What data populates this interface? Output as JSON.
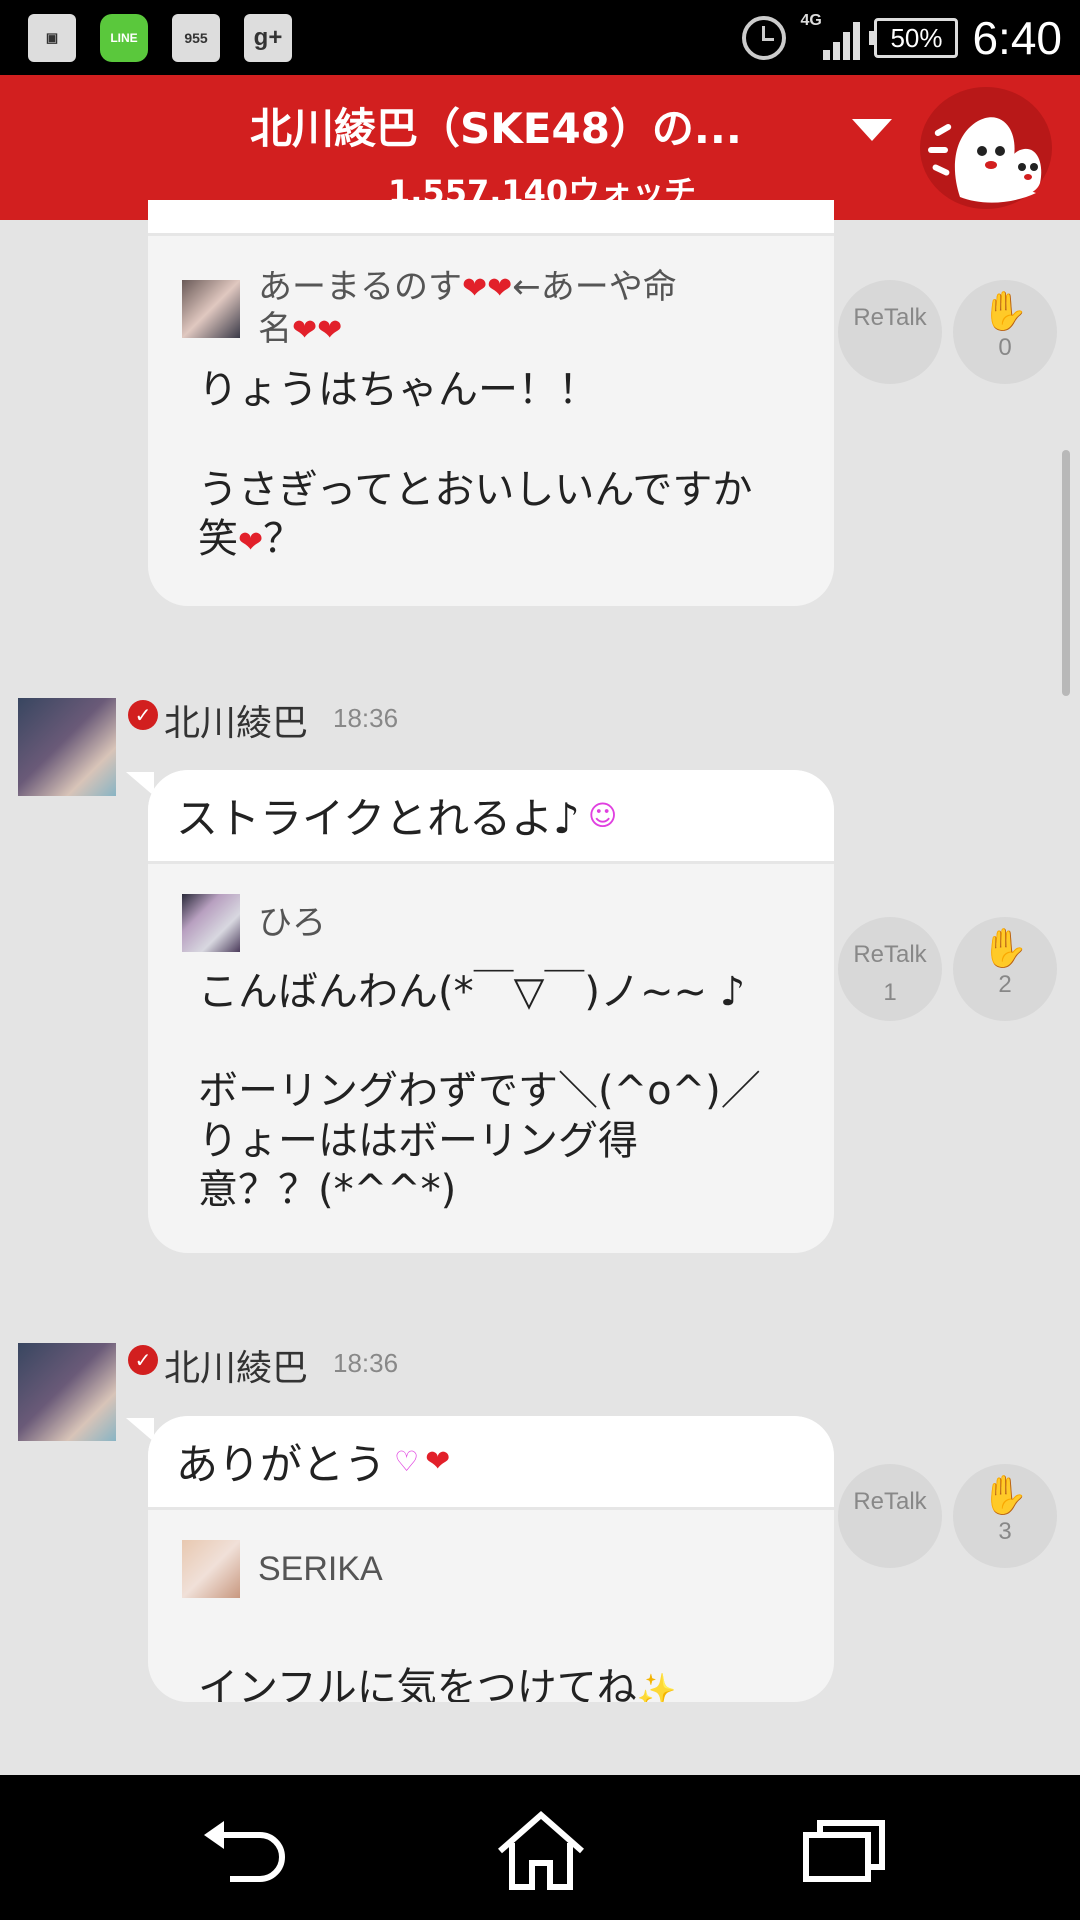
{
  "status_bar": {
    "icons": [
      "gallery-icon",
      "line-icon",
      "955-icon",
      "google-plus-icon"
    ],
    "line_label": "LINE",
    "app3_label": "955",
    "gplus_label": "g+",
    "network": "4G",
    "battery": "50%",
    "time": "6:40"
  },
  "header": {
    "title": "北川綾巴（SKE48）の...",
    "watch_count": "1,557,140ウォッチ"
  },
  "actions": {
    "retalk": "ReTalk"
  },
  "messages": [
    {
      "reply_name_a": "あーまるのす",
      "reply_name_b": "←あーや命",
      "reply_name_c": "名",
      "reply_line1": "りょうはちゃんー！！",
      "reply_line2": "うさぎってとおいしいんですか",
      "reply_line3": "笑",
      "reply_line3_end": "？",
      "retalk_count": "",
      "clap_count": "0"
    },
    {
      "sender": "北川綾巴",
      "time": "18:36",
      "text": "ストライクとれるよ♪",
      "reply_name": "ひろ",
      "reply_text": "こんばんわん(*￣▽￣)ノ~~ ♪\n\nボーリングわずです＼(^o^)／\nりょーははボーリング得\n意？？(*^^*)",
      "retalk_count": "1",
      "clap_count": "2"
    },
    {
      "sender": "北川綾巴",
      "time": "18:36",
      "text": "ありがとう",
      "reply_name": "SERIKA",
      "reply_text": "インフルに気をつけてね",
      "retalk_count": "",
      "clap_count": "3"
    }
  ],
  "colors": {
    "brand_red": "#d21f1f",
    "background": "#e4e4e4"
  }
}
